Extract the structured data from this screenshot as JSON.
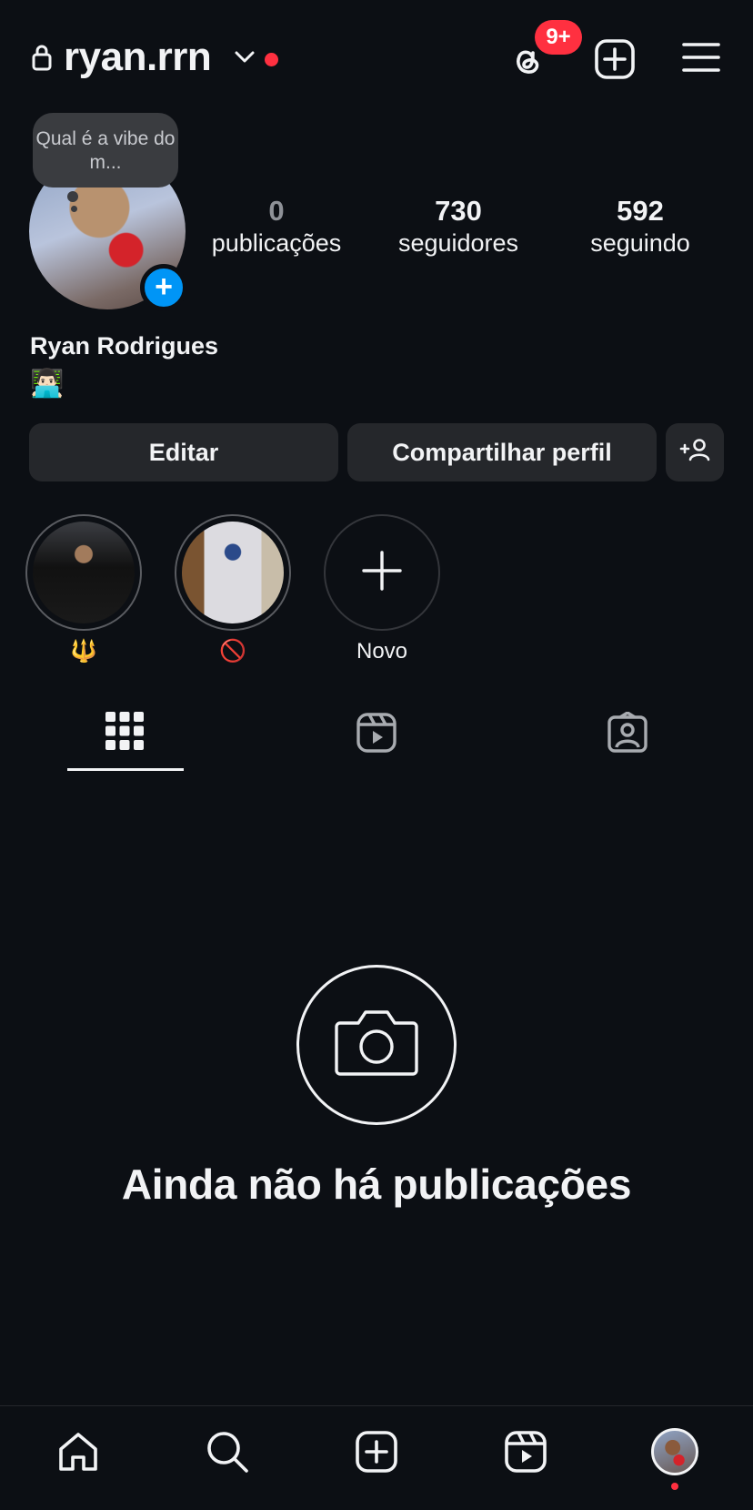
{
  "header": {
    "username": "ryan.rrn",
    "threads_badge": "9+",
    "icons": [
      "lock-icon",
      "chevron-down-icon",
      "threads-icon",
      "add-post-icon",
      "menu-icon"
    ]
  },
  "profile": {
    "note": "Qual é a vibe do m...",
    "stats": [
      {
        "value": "0",
        "label": "publicações"
      },
      {
        "value": "730",
        "label": "seguidores"
      },
      {
        "value": "592",
        "label": "seguindo"
      }
    ],
    "name": "Ryan Rodrigues",
    "bio": "👨🏻‍💻"
  },
  "actions": {
    "edit_label": "Editar",
    "share_label": "Compartilhar perfil"
  },
  "highlights": [
    {
      "label": "🔱"
    },
    {
      "label": "🚫"
    },
    {
      "label": "Novo"
    }
  ],
  "tabs": [
    "grid-icon",
    "reels-icon",
    "tagged-icon"
  ],
  "empty_state": {
    "title": "Ainda não há publicações"
  },
  "bottom_nav": [
    "home-icon",
    "search-icon",
    "create-icon",
    "reels-icon",
    "profile-avatar"
  ],
  "colors": {
    "background": "#0c0f14",
    "button": "#25272b",
    "badge": "#ff3040",
    "accent": "#0095f6"
  }
}
